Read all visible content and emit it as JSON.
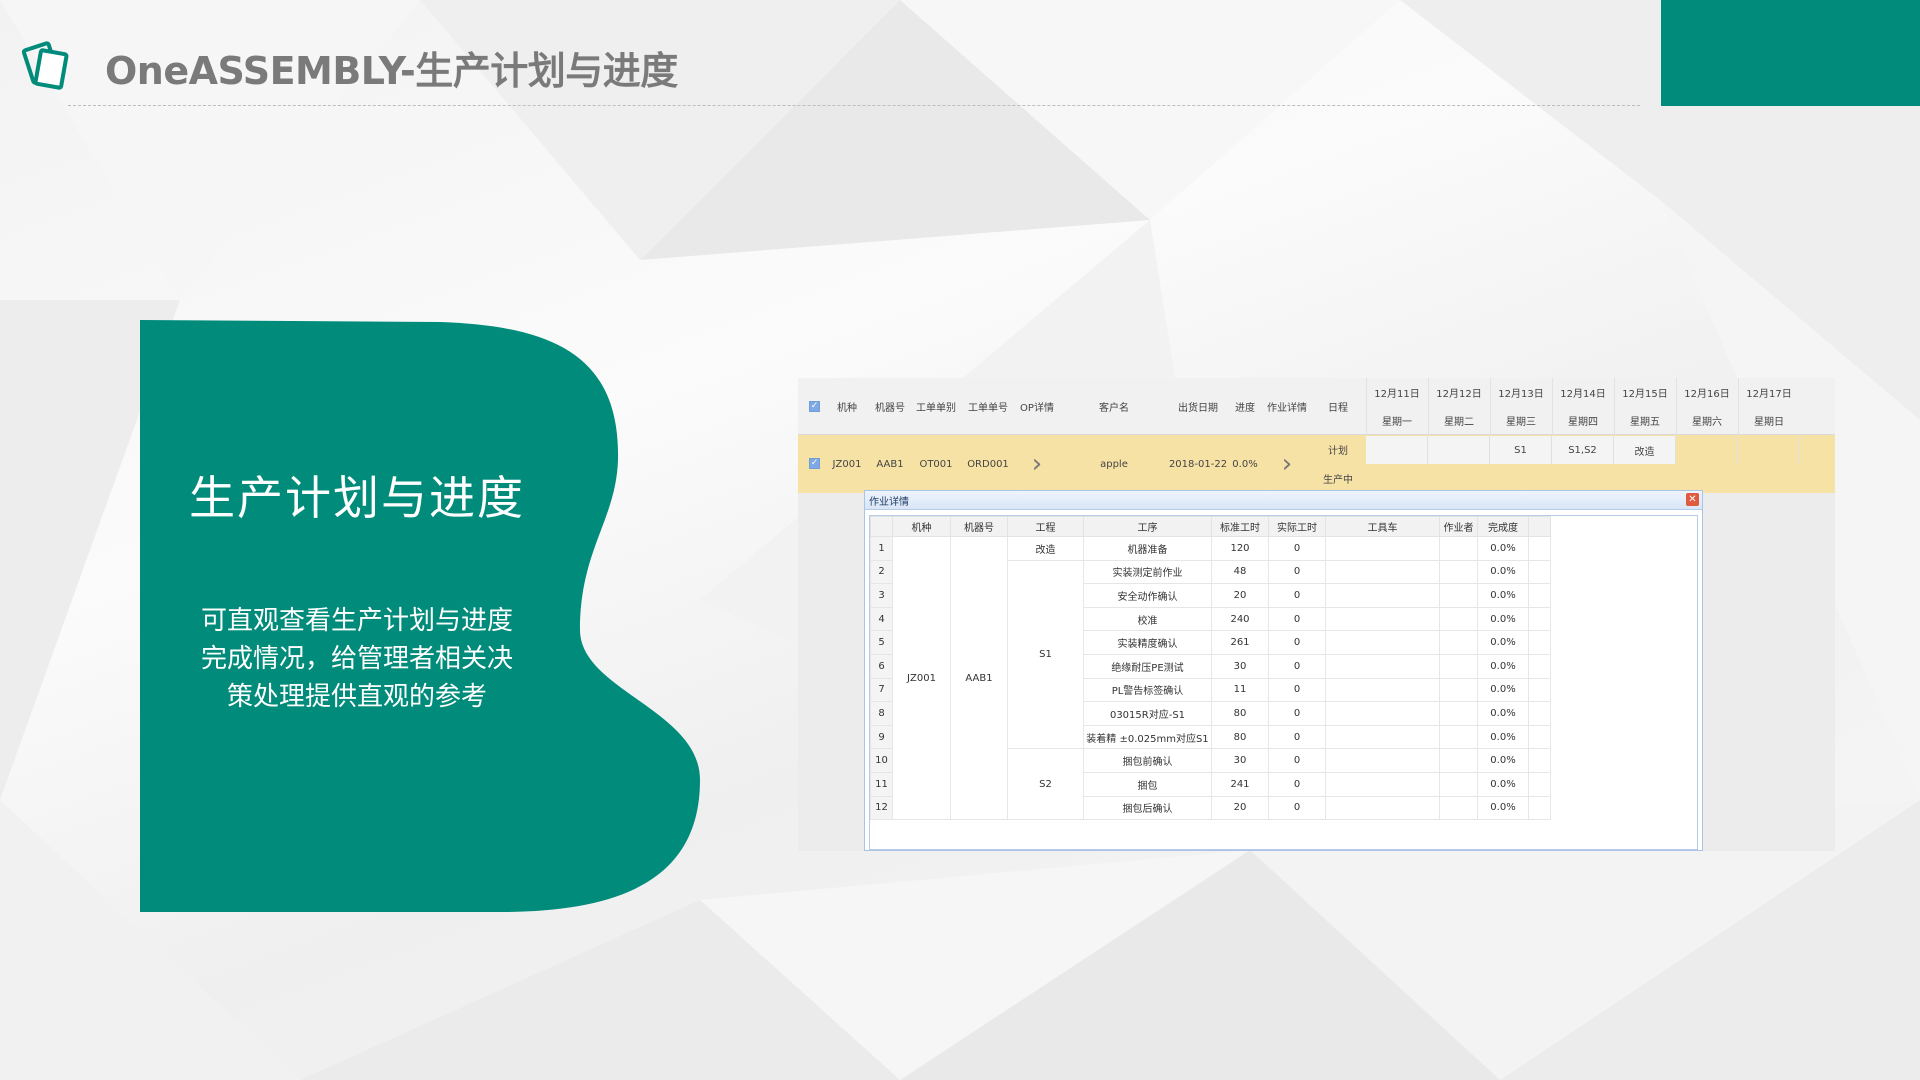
{
  "header": {
    "title": "OneASSEMBLY-生产计划与进度",
    "logo_icon": "stacked-cards-icon",
    "accent_color": "#008b7a"
  },
  "card": {
    "title": "生产计划与进度",
    "description_lines": [
      "可直观查看生产计划与进度",
      "完成情况，给管理者相关决",
      "策处理提供直观的参考"
    ],
    "color": "#008b7a"
  },
  "grid": {
    "headers": [
      "机种",
      "机器号",
      "工单单别",
      "工单单号",
      "OP详情",
      "客户名",
      "出货日期",
      "进度",
      "作业详情",
      "日程"
    ],
    "dates": [
      {
        "date": "12月11日",
        "weekday": "星期一"
      },
      {
        "date": "12月12日",
        "weekday": "星期二"
      },
      {
        "date": "12月13日",
        "weekday": "星期三"
      },
      {
        "date": "12月14日",
        "weekday": "星期四"
      },
      {
        "date": "12月15日",
        "weekday": "星期五"
      },
      {
        "date": "12月16日",
        "weekday": "星期六"
      },
      {
        "date": "12月17日",
        "weekday": "星期日"
      }
    ],
    "row": {
      "model": "JZ001",
      "machine": "AAB1",
      "order_type": "OT001",
      "order_no": "ORD001",
      "customer": "apple",
      "ship_date": "2018-01-22",
      "progress": "0.0%",
      "schedule_plan": "计划",
      "schedule_prod": "生产中",
      "plan_days": [
        "",
        "",
        "S1",
        "S1,S2",
        "改造",
        "",
        ""
      ]
    }
  },
  "dialog": {
    "title": "作业详情",
    "columns": [
      "机种",
      "机器号",
      "工程",
      "工序",
      "标准工时",
      "实际工时",
      "工具车",
      "作业者",
      "完成度"
    ],
    "model": "JZ001",
    "machine": "AAB1",
    "stages": [
      "改造",
      "S1",
      "S2"
    ],
    "rows": [
      {
        "n": "1",
        "proc": "机器准备",
        "std": "120",
        "act": "0",
        "done": "0.0%"
      },
      {
        "n": "2",
        "proc": "实装测定前作业",
        "std": "48",
        "act": "0",
        "done": "0.0%"
      },
      {
        "n": "3",
        "proc": "安全动作确认",
        "std": "20",
        "act": "0",
        "done": "0.0%"
      },
      {
        "n": "4",
        "proc": "校准",
        "std": "240",
        "act": "0",
        "done": "0.0%"
      },
      {
        "n": "5",
        "proc": "实装精度确认",
        "std": "261",
        "act": "0",
        "done": "0.0%"
      },
      {
        "n": "6",
        "proc": "绝缘耐压PE测试",
        "std": "30",
        "act": "0",
        "done": "0.0%"
      },
      {
        "n": "7",
        "proc": "PL警告标签确认",
        "std": "11",
        "act": "0",
        "done": "0.0%"
      },
      {
        "n": "8",
        "proc": "03015R对应-S1",
        "std": "80",
        "act": "0",
        "done": "0.0%"
      },
      {
        "n": "9",
        "proc": "装着精 ±0.025mm对应S1",
        "std": "80",
        "act": "0",
        "done": "0.0%"
      },
      {
        "n": "10",
        "proc": "捆包前确认",
        "std": "30",
        "act": "0",
        "done": "0.0%"
      },
      {
        "n": "11",
        "proc": "捆包",
        "std": "241",
        "act": "0",
        "done": "0.0%"
      },
      {
        "n": "12",
        "proc": "捆包后确认",
        "std": "20",
        "act": "0",
        "done": "0.0%"
      }
    ]
  }
}
